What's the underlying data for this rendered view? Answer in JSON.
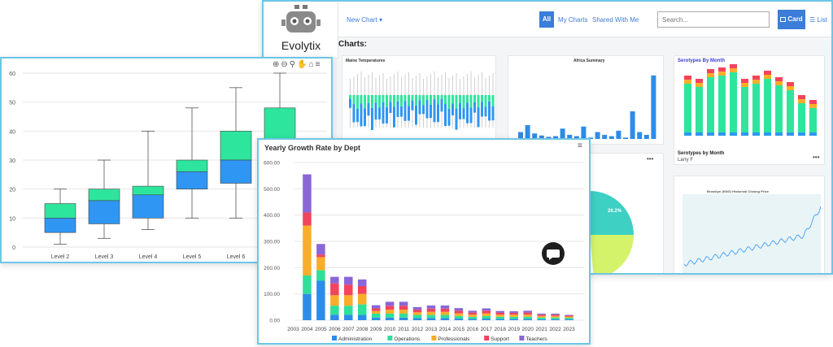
{
  "app": {
    "logo_text": "Evolytix",
    "new_chart_label": "New Chart ▾",
    "filter_all": "All",
    "filter_my": "My Charts",
    "filter_shared": "Shared With Me",
    "search_placeholder": "Search...",
    "view_card": "Card",
    "view_list": "List",
    "charts_heading": "Charts:",
    "cards": [
      {
        "title": "Maine Temperatures"
      },
      {
        "title": "Africa Summary"
      },
      {
        "title": "Serotypes By Month",
        "footer_title": "Serotypes by Month",
        "footer_author": "Larry F"
      },
      {
        "title": ""
      },
      {
        "title": "Brooklyn (KNG) Historical Closing Price"
      }
    ],
    "pie_label": "26.2%",
    "more_icon": "ellipsis-icon"
  },
  "colors": {
    "accent": "#3b7dd8",
    "panel_border": "#6ec6e6",
    "box_upper": "#2ee59d",
    "box_lower": "#2f96f3",
    "administration": "#2d8ce8",
    "operations": "#2ee09a",
    "professionals": "#f9ae2a",
    "support": "#f4435d",
    "teachers": "#8a66d6"
  },
  "chart_data": [
    {
      "type": "boxplot",
      "title": "",
      "toolbar_icons": [
        "zoom-in-icon",
        "zoom-out-icon",
        "magnify-icon",
        "pan-icon",
        "home-icon",
        "menu-icon"
      ],
      "categories": [
        "Level 2",
        "Level 3",
        "Level 4",
        "Level 5",
        "Level 6",
        ""
      ],
      "boxes": [
        {
          "min": 1,
          "q1": 5,
          "median": 10,
          "q3": 15,
          "max": 20
        },
        {
          "min": 3,
          "q1": 8,
          "median": 16,
          "q3": 20,
          "max": 30
        },
        {
          "min": 6,
          "q1": 10,
          "median": 18,
          "q3": 21,
          "max": 40
        },
        {
          "min": 10,
          "q1": 20,
          "median": 26,
          "q3": 30,
          "max": 48
        },
        {
          "min": 10,
          "q1": 22,
          "median": 30,
          "q3": 40,
          "max": 55
        },
        {
          "min": 12,
          "q1": 28,
          "median": 36,
          "q3": 48,
          "max": 60
        }
      ],
      "yticks": [
        0,
        10,
        20,
        30,
        40,
        50,
        60
      ],
      "ylim": [
        0,
        60
      ]
    },
    {
      "type": "bar",
      "stacked": true,
      "title": "Yearly Growth Rate by Dept",
      "categories": [
        "2003",
        "2004",
        "2005",
        "2006",
        "2007",
        "2008",
        "2009",
        "2010",
        "2011",
        "2012",
        "2013",
        "2014",
        "2015",
        "2016",
        "2017",
        "2018",
        "2019",
        "2020",
        "2021",
        "2022",
        "2023"
      ],
      "series": [
        {
          "name": "Administration",
          "values": [
            0,
            100,
            150,
            20,
            20,
            20,
            10,
            10,
            10,
            8,
            8,
            8,
            6,
            5,
            6,
            5,
            5,
            5,
            4,
            4,
            4
          ]
        },
        {
          "name": "Operations",
          "values": [
            0,
            70,
            40,
            35,
            35,
            40,
            15,
            15,
            15,
            12,
            12,
            12,
            10,
            8,
            10,
            8,
            8,
            8,
            6,
            6,
            5
          ]
        },
        {
          "name": "Professionals",
          "values": [
            0,
            190,
            50,
            40,
            40,
            40,
            10,
            15,
            15,
            10,
            12,
            12,
            10,
            8,
            10,
            8,
            8,
            8,
            6,
            6,
            5
          ]
        },
        {
          "name": "Support",
          "values": [
            0,
            50,
            10,
            45,
            40,
            30,
            10,
            15,
            15,
            10,
            12,
            12,
            10,
            8,
            10,
            8,
            7,
            8,
            5,
            5,
            3
          ]
        },
        {
          "name": "Teachers",
          "values": [
            0,
            145,
            40,
            25,
            30,
            25,
            12,
            15,
            15,
            10,
            12,
            12,
            10,
            7,
            9,
            6,
            6,
            7,
            4,
            4,
            3
          ]
        }
      ],
      "yticks": [
        "0.00",
        "100.00",
        "200.00",
        "300.00",
        "400.00",
        "500.00",
        "600.00"
      ],
      "ylim": [
        0,
        600
      ],
      "legend_position": "bottom"
    }
  ]
}
